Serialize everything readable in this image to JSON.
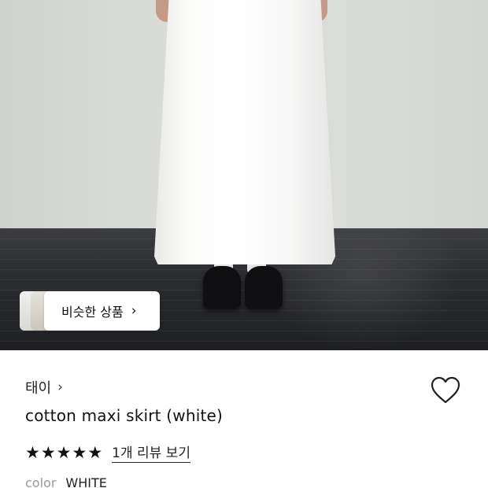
{
  "similar_products": {
    "label": "비슷한 상품",
    "chevron_icon": "chevron-right-icon"
  },
  "brand": {
    "name": "태이",
    "chevron_icon": "chevron-right-icon"
  },
  "wishlist": {
    "icon": "heart-outline-icon"
  },
  "product": {
    "title": "cotton maxi skirt (white)"
  },
  "rating": {
    "stars": 5,
    "max": 5,
    "review_link": "1개 리뷰 보기"
  },
  "option": {
    "label": "color",
    "value": "WHITE"
  }
}
